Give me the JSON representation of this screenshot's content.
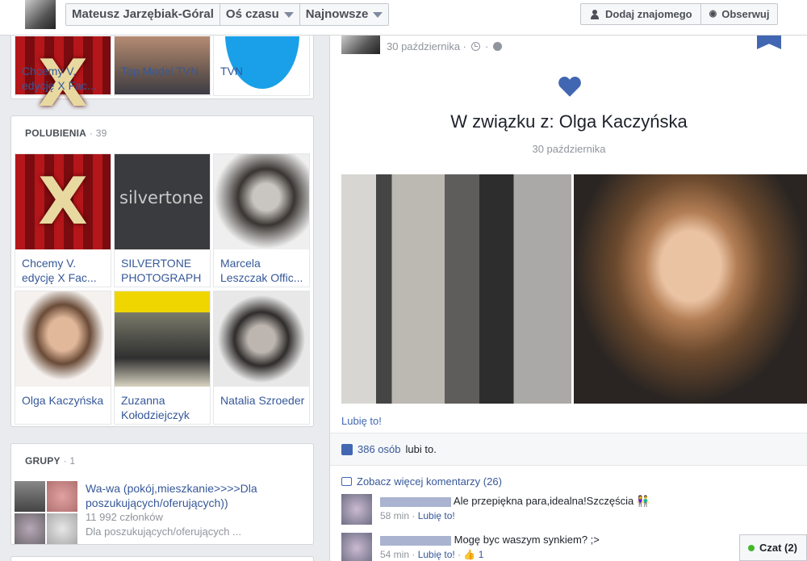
{
  "topbar": {
    "name": "Mateusz Jarzębiak-Góral",
    "timeline": "Oś czasu",
    "sort": "Najnowsze",
    "add_friend": "Dodaj znajomego",
    "follow": "Obserwuj"
  },
  "strip": {
    "tiles": [
      {
        "caption": "Chcemy V. edycję X Fac..."
      },
      {
        "caption": "Top Model TVN"
      },
      {
        "caption": "TVN"
      }
    ]
  },
  "likes": {
    "title": "POLUBIENIA",
    "count": "· 39",
    "tiles": [
      {
        "caption": "Chcemy V. edycję X Fac..."
      },
      {
        "caption": "SILVERTONE PHOTOGRAPH"
      },
      {
        "caption": "Marcela Leszczak Offic..."
      },
      {
        "caption": "Olga Kaczyńska"
      },
      {
        "caption": "Zuzanna Kołodziejczyk"
      },
      {
        "caption": "Natalia Szroeder"
      }
    ]
  },
  "groups": {
    "title": "GRUPY",
    "count": "· 1",
    "item": {
      "name": "Wa-wa (pokój,mieszkanie>>>>Dla poszukujących/oferujących))",
      "members": "11 992 członków",
      "desc": "Dla poszukujących/oferujących ..."
    }
  },
  "post": {
    "date": "30 października ·",
    "relationship": "W związku z: Olga Kaczyńska",
    "event_date": "30 października",
    "like_link": "Lubię to!",
    "likes_count": "386 osób",
    "likes_suffix": "lubi to.",
    "more_comments": "Zobacz więcej komentarzy (26)",
    "comments": [
      {
        "text": "Ale przepiękna para,idealna!Szczęścia",
        "time": "58 min",
        "action": "Lubię to!",
        "likes": ""
      },
      {
        "text": "Mogę byc waszym synkiem? ;>",
        "time": "54 min",
        "action": "Lubię to!",
        "likes": "1"
      }
    ]
  },
  "chat": {
    "label": "Czat (2)"
  }
}
